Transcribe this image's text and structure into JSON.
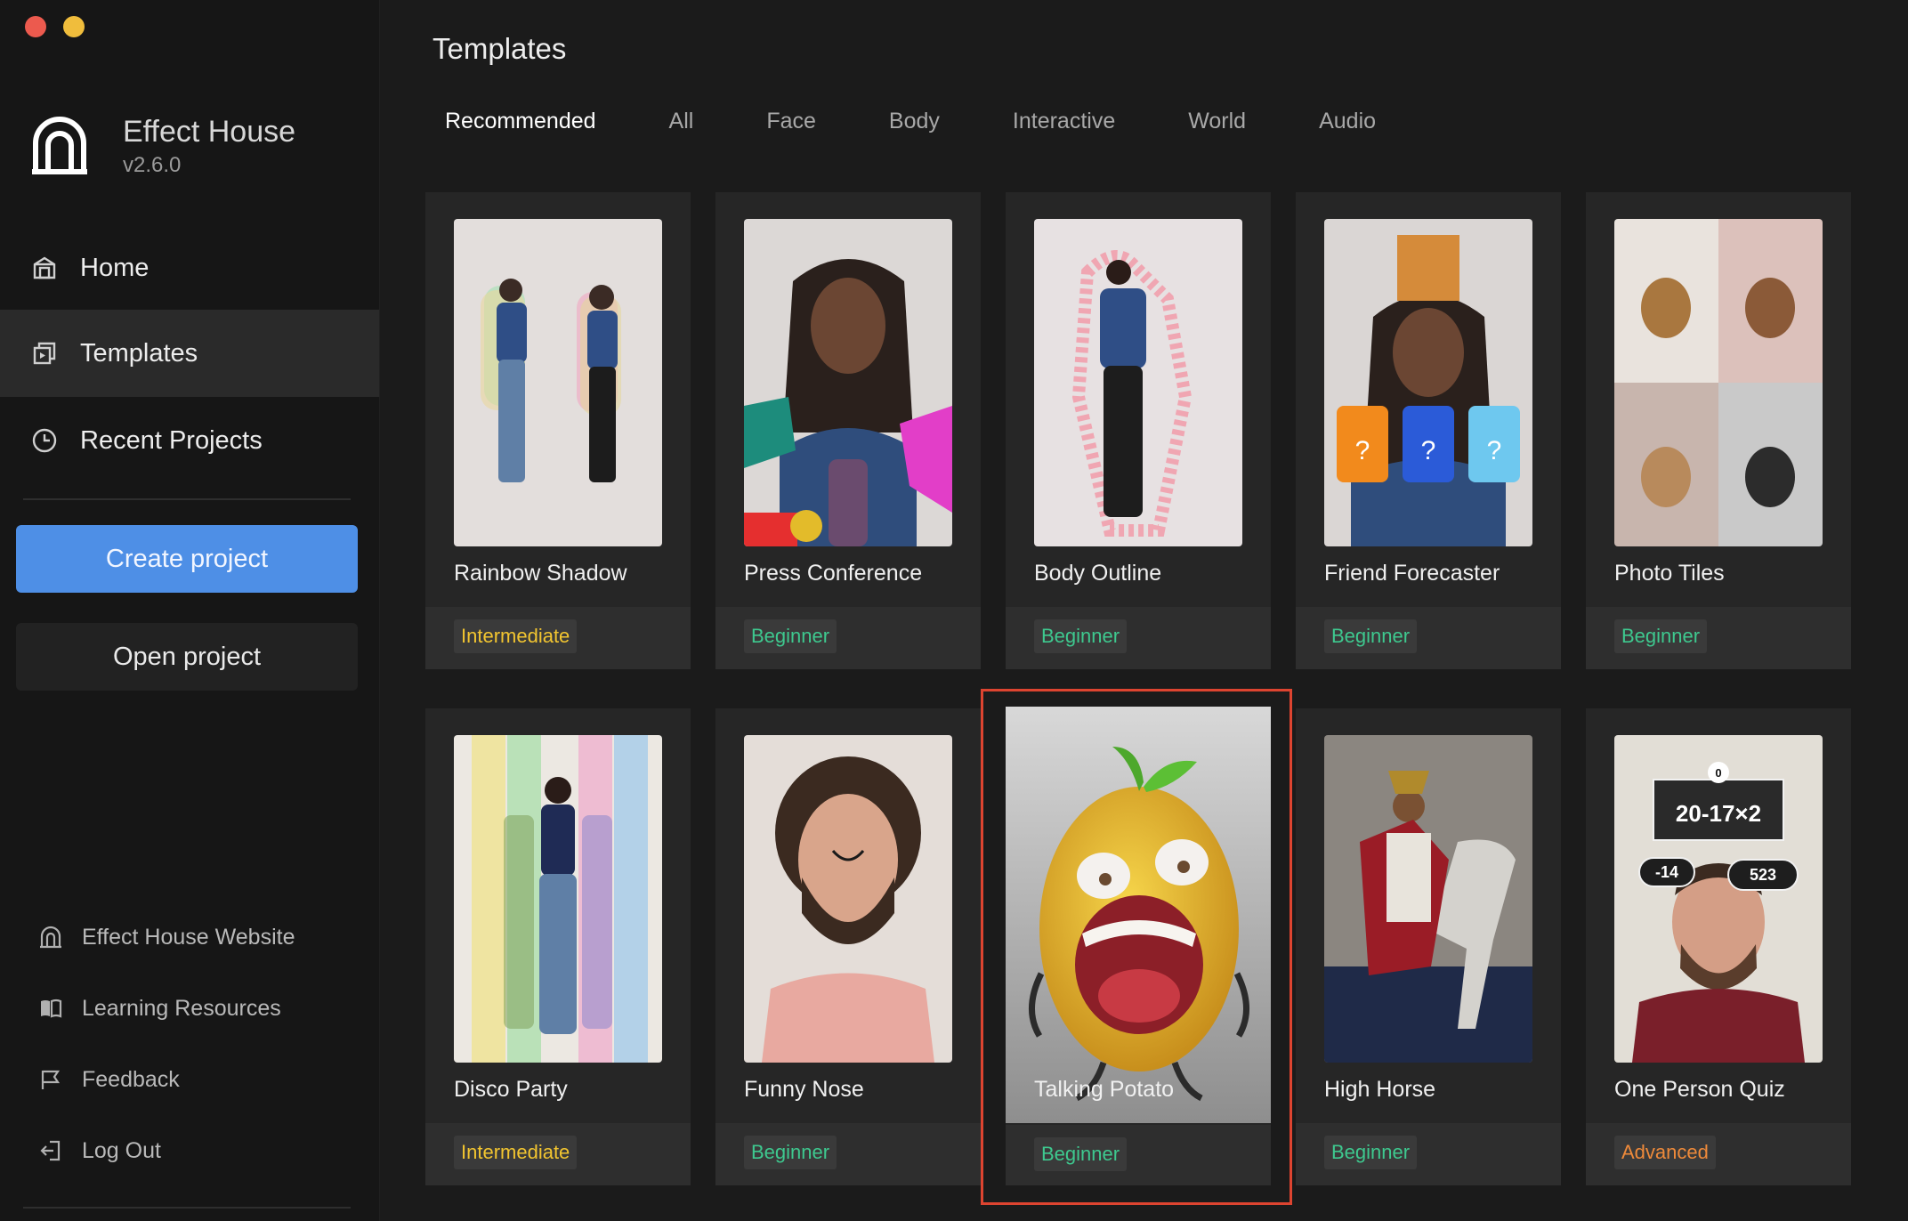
{
  "window": {
    "controls": [
      "close",
      "minimize"
    ]
  },
  "brand": {
    "name": "Effect House",
    "version": "v2.6.0"
  },
  "nav": [
    {
      "label": "Home",
      "icon": "home-icon"
    },
    {
      "label": "Templates",
      "icon": "templates-icon",
      "active": true
    },
    {
      "label": "Recent Projects",
      "icon": "clock-icon"
    }
  ],
  "actions": {
    "create": "Create project",
    "open": "Open project"
  },
  "footer_links": [
    {
      "label": "Effect House Website",
      "icon": "website-icon"
    },
    {
      "label": "Learning Resources",
      "icon": "book-icon"
    },
    {
      "label": "Feedback",
      "icon": "flag-icon"
    },
    {
      "label": "Log Out",
      "icon": "logout-icon"
    }
  ],
  "page": {
    "title": "Templates"
  },
  "tabs": [
    "Recommended",
    "All",
    "Face",
    "Body",
    "Interactive",
    "World",
    "Audio"
  ],
  "active_tab": "Recommended",
  "templates": [
    {
      "title": "Rainbow Shadow",
      "level": "Intermediate"
    },
    {
      "title": "Press Conference",
      "level": "Beginner"
    },
    {
      "title": "Body Outline",
      "level": "Beginner"
    },
    {
      "title": "Friend Forecaster",
      "level": "Beginner"
    },
    {
      "title": "Photo Tiles",
      "level": "Beginner"
    },
    {
      "title": "Disco Party",
      "level": "Intermediate"
    },
    {
      "title": "Funny Nose",
      "level": "Beginner"
    },
    {
      "title": "Talking Potato",
      "level": "Beginner",
      "selected": true
    },
    {
      "title": "High Horse",
      "level": "Beginner"
    },
    {
      "title": "One Person Quiz",
      "level": "Advanced"
    }
  ],
  "thumb_text": {
    "quiz_question": "20-17×2",
    "quiz_left": "-14",
    "quiz_right": "523",
    "quiz_timer": "0"
  },
  "colors": {
    "accent": "#4e8fe6",
    "close": "#ec5a4e",
    "minimize": "#f0bd3c",
    "selection": "#dd4430",
    "intermediate": "#f2c530",
    "beginner": "#3ec98f",
    "advanced": "#ee8a3a"
  }
}
